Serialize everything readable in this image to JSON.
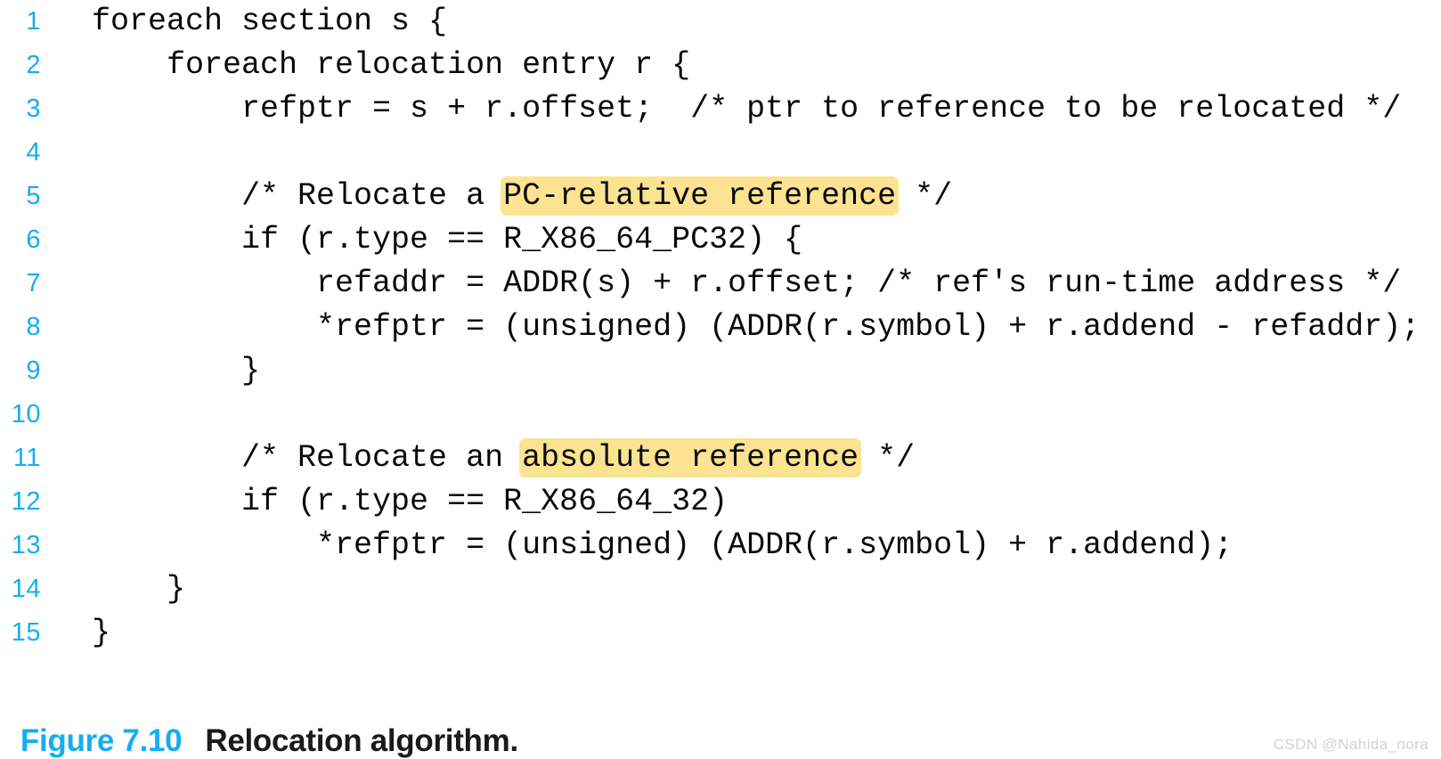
{
  "figure": {
    "label": "Figure 7.10",
    "title": "Relocation algorithm.",
    "label_color": "#14AEEF",
    "title_color": "#1a1a1a"
  },
  "code": {
    "language": "c-pseudocode",
    "font": "monospace",
    "text_color": "#0a0a0a",
    "line_number_color": "#14AEEF",
    "highlight_color": "#FBE391",
    "background_color": "#ffffff",
    "lines": [
      {
        "number": "1",
        "text": "foreach section s {"
      },
      {
        "number": "2",
        "text": "    foreach relocation entry r {"
      },
      {
        "number": "3",
        "pre": "        refptr = s + r.offset;  /* ptr to reference to be relocated */"
      },
      {
        "number": "4",
        "text": ""
      },
      {
        "number": "5",
        "pre": "        /* Relocate a ",
        "hl": "PC-relative reference",
        "post": " */"
      },
      {
        "number": "6",
        "pre": "        if (r.type == R_X86_64_PC32) {"
      },
      {
        "number": "7",
        "pre": "            refaddr = ADDR(s) + r.offset; /* ref's run-time address */"
      },
      {
        "number": "8",
        "pre": "            *refptr = (unsigned) (ADDR(r.symbol) + r.addend - refaddr);"
      },
      {
        "number": "9",
        "pre": "        }"
      },
      {
        "number": "10",
        "text": ""
      },
      {
        "number": "11",
        "pre": "        /* Relocate an ",
        "hl": "absolute reference",
        "post": " */"
      },
      {
        "number": "12",
        "pre": "        if (r.type == R_X86_64_32)"
      },
      {
        "number": "13",
        "pre": "            *refptr = (unsigned) (ADDR(r.symbol) + r.addend);"
      },
      {
        "number": "14",
        "pre": "    }"
      },
      {
        "number": "15",
        "pre": "}"
      }
    ]
  },
  "watermark": {
    "text": "CSDN @Nahida_nora"
  }
}
